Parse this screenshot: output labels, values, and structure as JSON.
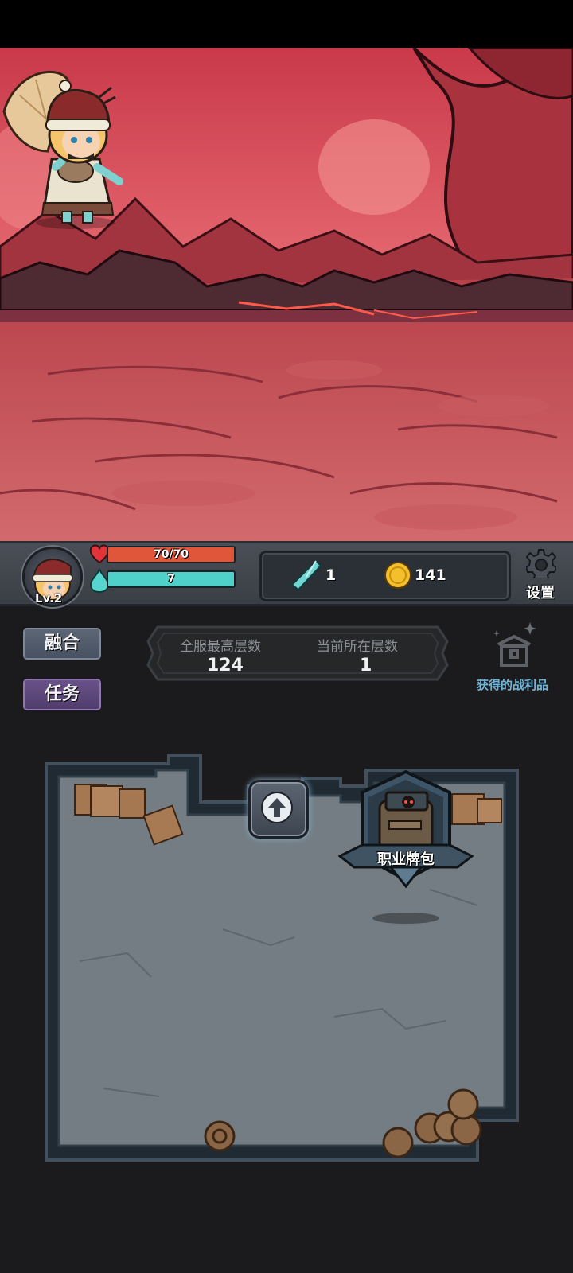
{
  "player": {
    "level_label": "Lv.2",
    "hp_text": "70/70",
    "hp_fraction": 1.0,
    "mp_text": "7",
    "mp_fraction": 1.0
  },
  "resources": {
    "crystal_count": "1",
    "coin_count": "141"
  },
  "settings": {
    "label": "设置"
  },
  "buttons": {
    "fuse_label": "融合",
    "task_label": "任务"
  },
  "floors": {
    "server_best_label": "全服最高层数",
    "server_best_value": "124",
    "current_label": "当前所在层数",
    "current_value": "1"
  },
  "loot": {
    "label": "获得的战利品"
  },
  "room": {
    "card_pack_label": "职业牌包"
  },
  "colors": {
    "hp_bar": "#e0563a",
    "mp_bar": "#4fd0c9",
    "scene_red": "#c8474f",
    "task_button": "#5b4579",
    "loot_text": "#6fb5d9"
  }
}
